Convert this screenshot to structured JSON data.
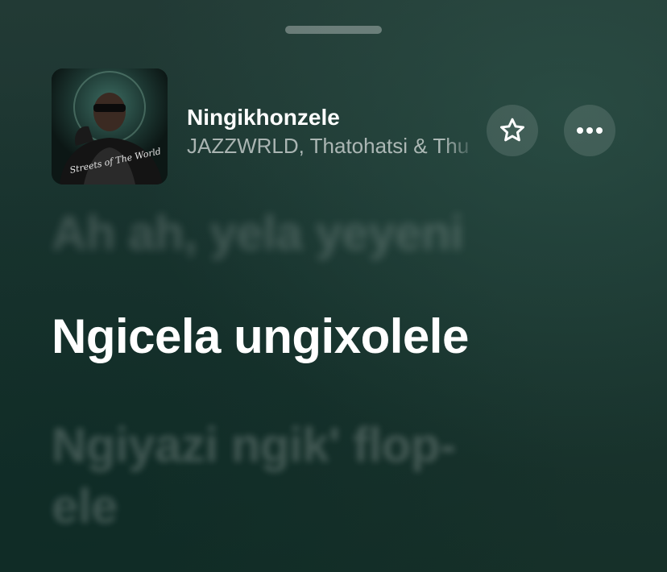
{
  "track": {
    "title": "Ningikhonzele",
    "artist": "JAZZWRLD, Thatohatsi & Thu",
    "artwork_text": "Streets of The World"
  },
  "controls": {
    "favorite_icon": "star-icon",
    "more_icon": "ellipsis-icon"
  },
  "lyrics": {
    "previous": "Ah ah, yela yeyeni",
    "current": "Ngicela ungixolele",
    "next": "Ngiyazi ngik' flop-ele"
  },
  "colors": {
    "background": "#1b3530",
    "text_active": "#ffffff"
  }
}
